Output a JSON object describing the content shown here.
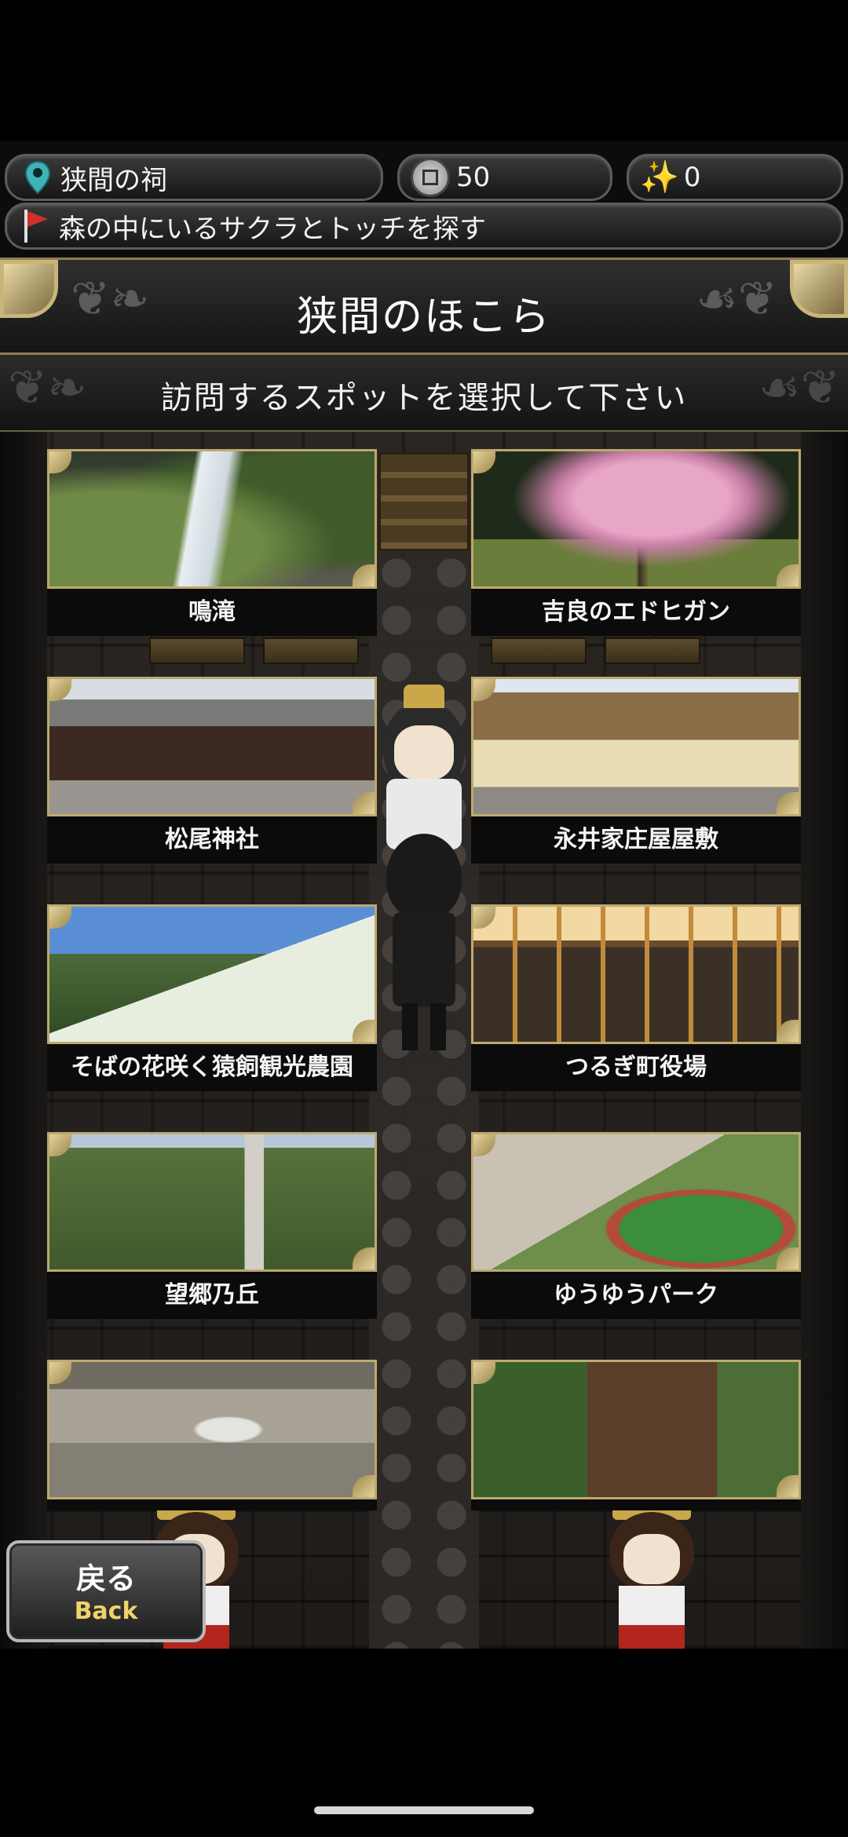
{
  "hud": {
    "location": "狭間の祠",
    "coins": "50",
    "stars": "0",
    "mission": "森の中にいるサクラとトッチを探す"
  },
  "banner": {
    "title": "狭間のほこら",
    "subtitle": "訪問するスポットを選択して下さい"
  },
  "spots": [
    {
      "label": "鳴滝"
    },
    {
      "label": "吉良のエドヒガン"
    },
    {
      "label": "松尾神社"
    },
    {
      "label": "永井家庄屋屋敷"
    },
    {
      "label": "そばの花咲く猿飼観光農園"
    },
    {
      "label": "つるぎ町役場"
    },
    {
      "label": "望郷乃丘"
    },
    {
      "label": "ゆうゆうパーク"
    },
    {
      "label": ""
    },
    {
      "label": ""
    }
  ],
  "back": {
    "jp": "戻る",
    "en": "Back"
  },
  "colors": {
    "gold": "#bda96f",
    "accent_yellow": "#f0d36a",
    "flag_red": "#d0322b",
    "pin_teal": "#3fb3b8"
  }
}
